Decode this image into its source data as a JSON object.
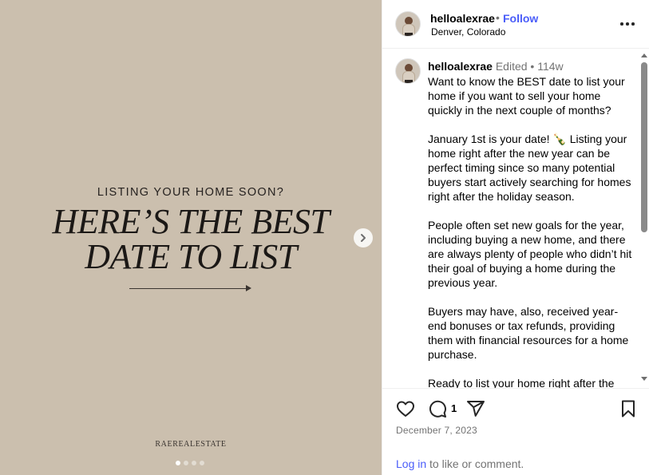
{
  "media": {
    "kicker": "LISTING YOUR HOME SOON?",
    "headline_line1": "HERE’S THE BEST",
    "headline_line2": "DATE TO LIST",
    "brand": "RAEREALESTATE",
    "slide_count": 4,
    "active_slide": 1,
    "background_color": "#cbbfae",
    "next_icon": "chevron-right-icon"
  },
  "post_header": {
    "username": "helloalexrae",
    "separator": "•",
    "follow_label": "Follow",
    "location": "Denver, Colorado",
    "more_icon": "more-options-icon"
  },
  "caption": {
    "username": "helloalexrae",
    "meta": "Edited • 114w",
    "text": "Want to know the BEST date to list your home if you want to sell your home quickly in the next couple of months?\n\nJanuary 1st is your date! 🍾 Listing your home right after the new year can be perfect timing since so many potential buyers start actively searching for homes right after the holiday season.\n\nPeople often set new goals for the year, including buying a new home, and there are always plenty of people who didn’t hit their goal of buying a home during the previous year.\n\nBuyers may have, also, received year-end bonuses or tax refunds, providing them with financial resources for a home purchase.\n\nReady to list your home right after the"
  },
  "actions": {
    "like_icon": "heart-icon",
    "comment_icon": "comment-icon",
    "comment_count": "1",
    "share_icon": "send-icon",
    "save_icon": "bookmark-icon",
    "date": "December 7, 2023",
    "login_link": "Log in",
    "login_rest": " to like or comment."
  },
  "colors": {
    "accent": "#4a5df9",
    "muted_text": "#737373"
  }
}
